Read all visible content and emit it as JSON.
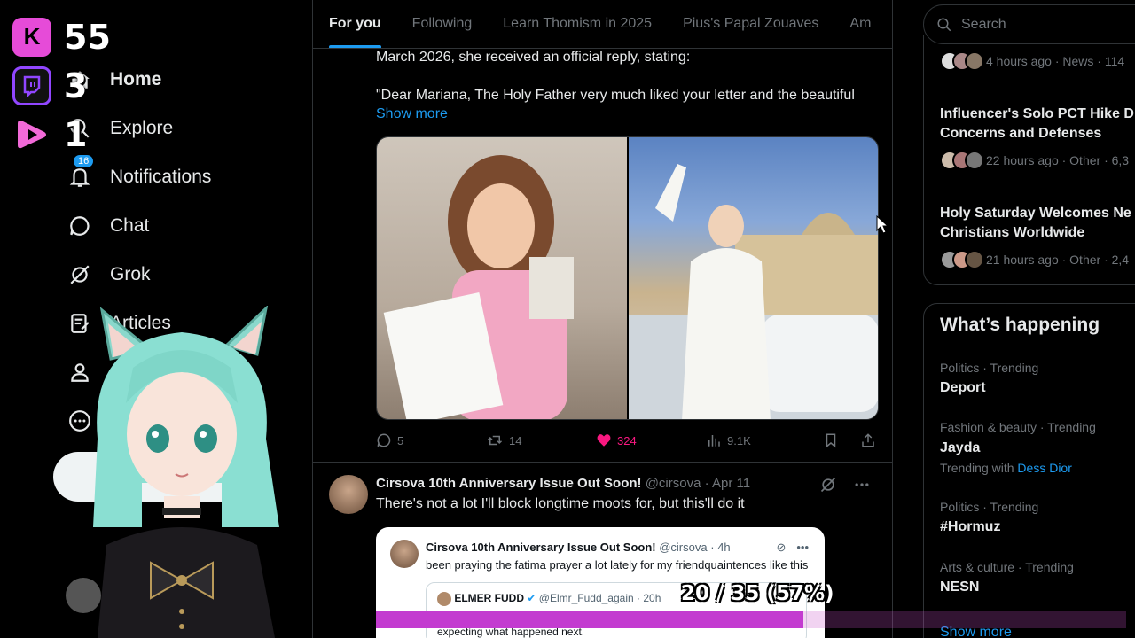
{
  "overlay": {
    "counters": [
      {
        "platform_icon": "kick-logo",
        "value": "55"
      },
      {
        "platform_icon": "twitch-logo",
        "value": "3"
      },
      {
        "platform_icon": "rumble-logo",
        "value": "1"
      }
    ]
  },
  "nav": {
    "items": [
      {
        "label": "Home",
        "icon": "home-icon"
      },
      {
        "label": "Explore",
        "icon": "search-icon"
      },
      {
        "label": "Notifications",
        "icon": "bell-icon",
        "badge": "16"
      },
      {
        "label": "Chat",
        "icon": "chat-icon"
      },
      {
        "label": "Grok",
        "icon": "grok-icon"
      },
      {
        "label": "Articles",
        "icon": "article-icon"
      },
      {
        "label": "",
        "icon": "profile-icon"
      },
      {
        "label": "",
        "icon": "more-icon"
      }
    ]
  },
  "tabs": [
    "For you",
    "Following",
    "Learn Thomism in 2025",
    "Pius's Papal Zouaves",
    "Am"
  ],
  "tweet1": {
    "line1": "March 2026, she received an official reply, stating:",
    "line2": "\"Dear Mariana, The Holy Father very much liked your letter and the beautiful",
    "show_more": "Show more",
    "replies": "5",
    "reposts": "14",
    "likes": "324",
    "views": "9.1K"
  },
  "tweet2": {
    "name": "Cirsova 10th Anniversary Issue Out Soon!",
    "handle": "@cirsova",
    "date": "Apr 11",
    "text": "There's not a lot I'll block longtime moots for, but this'll do it",
    "quote": {
      "name": "Cirsova 10th Anniversary Issue Out Soon!",
      "handle": "@cirsova",
      "time": "4h",
      "text": "been praying the fatima prayer a lot lately for my friendquaintences like this",
      "inner_name": "ELMER FUDD",
      "inner_handle": "@Elmr_Fudd_again",
      "inner_time": "20h",
      "inner_text": "expecting what happened next."
    }
  },
  "progress": {
    "text": "20 / 35 (57%)",
    "fraction": 0.57
  },
  "search": {
    "placeholder": "Search"
  },
  "news": [
    {
      "title": "",
      "meta": "4 hours ago · News · 114"
    },
    {
      "title": "Influencer's Solo PCT Hike D",
      "title2": "Concerns and Defenses",
      "meta": "22 hours ago · Other · 6,3"
    },
    {
      "title": "Holy Saturday Welcomes Ne",
      "title2": "Christians Worldwide",
      "meta": "21 hours ago · Other · 2,4"
    }
  ],
  "happening": {
    "title": "What’s happening",
    "trends": [
      {
        "category": "Politics · Trending",
        "name": "Deport"
      },
      {
        "category": "Fashion & beauty · Trending",
        "name": "Jayda",
        "with_prefix": "Trending with",
        "with_link": "Dess Dior"
      },
      {
        "category": "Politics · Trending",
        "name": "#Hormuz"
      },
      {
        "category": "Arts & culture · Trending",
        "name": "NESN"
      }
    ],
    "show_more": "Show more"
  },
  "colors": {
    "accent": "#1d9bf0",
    "like": "#f91880",
    "progress": "#c33bd0",
    "kick": "#e64bd8",
    "twitch": "#9146ff"
  }
}
